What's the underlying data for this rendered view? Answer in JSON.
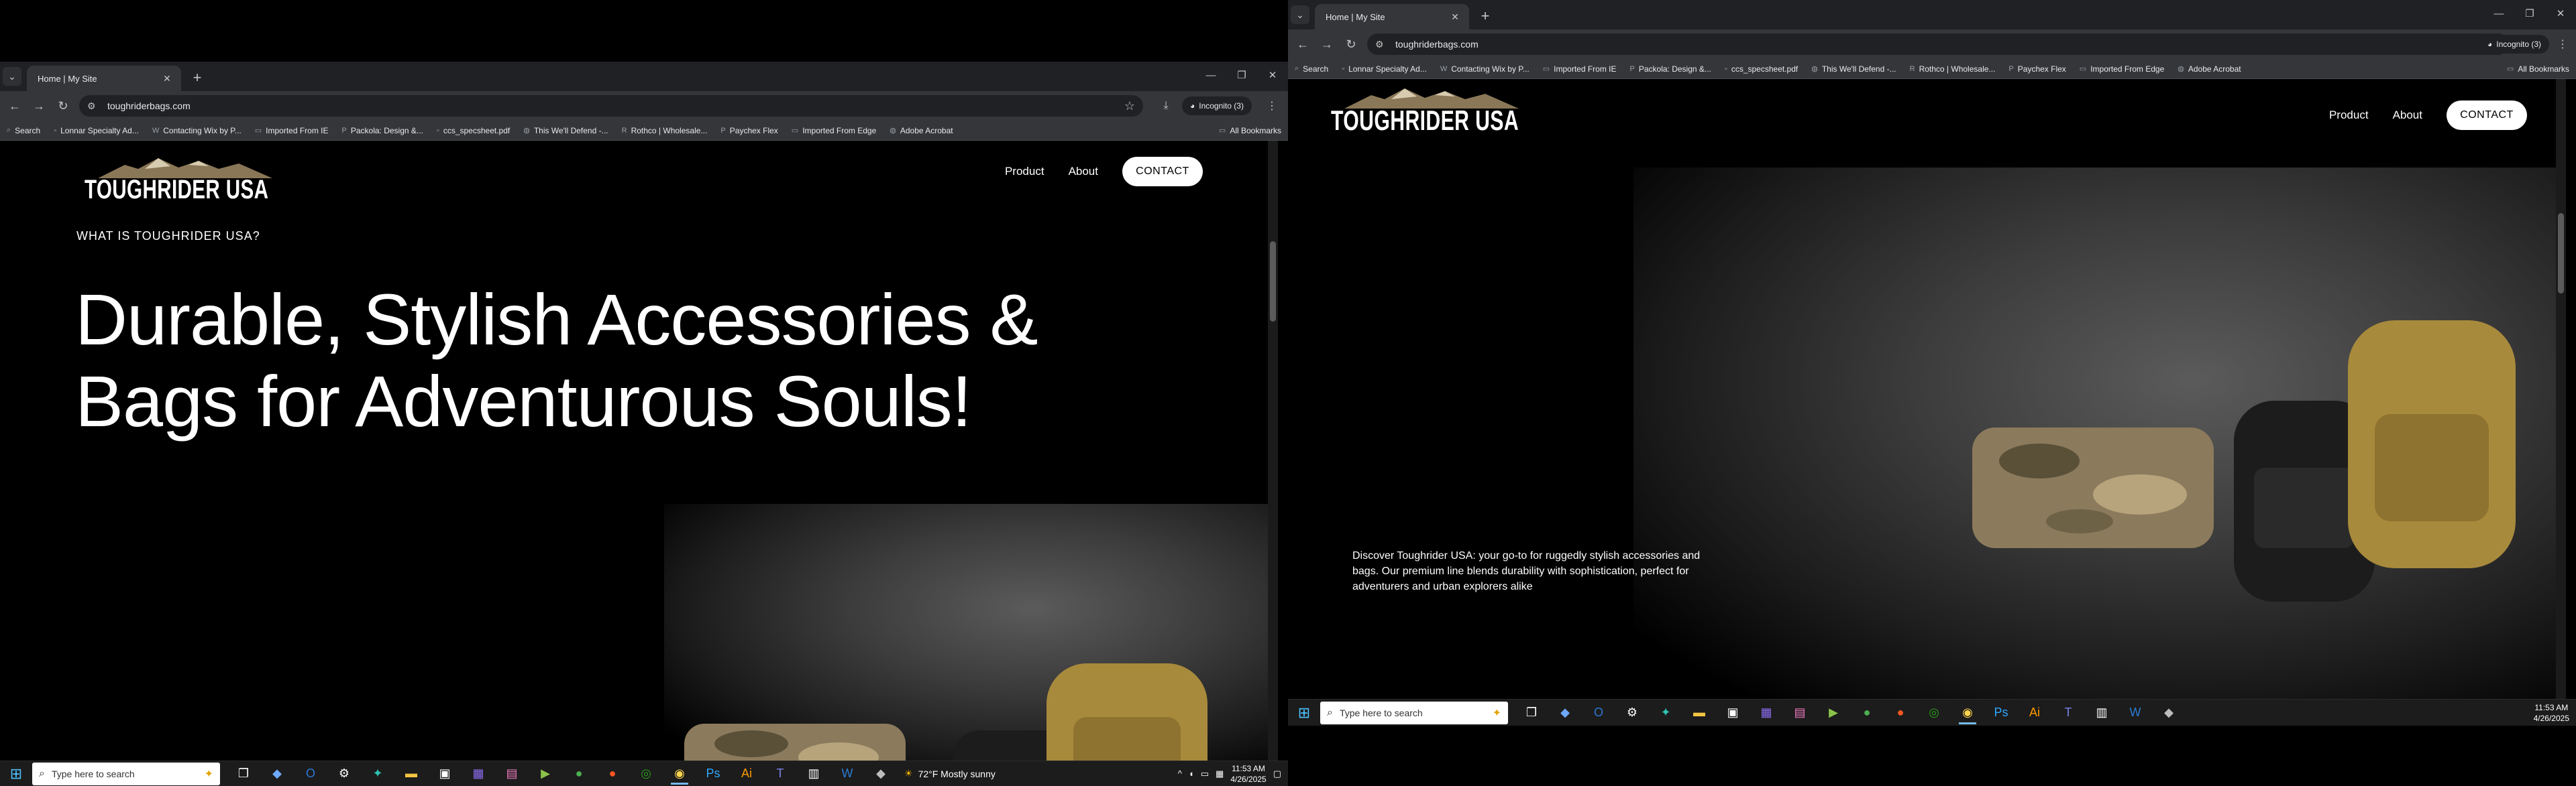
{
  "browser": {
    "tab_title": "Home | My Site",
    "url": "toughriderbags.com",
    "incognito_label": "Incognito (3)",
    "bookmarks": [
      {
        "icon": "search-icon",
        "label": "Search"
      },
      {
        "icon": "blank-icon",
        "label": "Lonnar Specialty Ad..."
      },
      {
        "icon": "wix-icon",
        "label": "Contacting Wix by P..."
      },
      {
        "icon": "folder-icon",
        "label": "Imported From IE"
      },
      {
        "icon": "pacsun-icon",
        "label": "Packola: Design &..."
      },
      {
        "icon": "blank-icon",
        "label": "ccs_specsheet.pdf"
      },
      {
        "icon": "globe-icon",
        "label": "This We'll Defend -..."
      },
      {
        "icon": "rothco-icon",
        "label": "Rothco | Wholesale..."
      },
      {
        "icon": "paychex-icon",
        "label": "Paychex Flex"
      },
      {
        "icon": "folder-icon",
        "label": "Imported From Edge"
      },
      {
        "icon": "globe-icon",
        "label": "Adobe Acrobat"
      }
    ],
    "all_bookmarks_label": "All Bookmarks"
  },
  "site": {
    "logo_text": "TOUGHRIDER USA",
    "nav": {
      "product": "Product",
      "about": "About",
      "contact": "CONTACT"
    },
    "eyebrow": "WHAT IS TOUGHRIDER USA?",
    "headline_line1": "Durable, Stylish Accessories &",
    "headline_line2": "Bags for Adventurous Souls!",
    "description": "Discover Toughrider USA: your go-to for ruggedly stylish accessories and bags. Our premium line blends durability with sophistication, perfect for adventurers and urban explorers alike"
  },
  "taskbar": {
    "search_placeholder": "Type here to search",
    "weather": "72°F  Mostly sunny",
    "time": "11:53 AM",
    "date": "4/26/2025",
    "apps": [
      {
        "name": "task-view-icon",
        "glyph": "❐",
        "color": "#ffffff"
      },
      {
        "name": "copilot-icon",
        "glyph": "◆",
        "color": "#6ea8ff"
      },
      {
        "name": "outlook-icon",
        "glyph": "O",
        "color": "#2b79d6"
      },
      {
        "name": "settings-icon",
        "glyph": "⚙",
        "color": "#ffffff"
      },
      {
        "name": "app-teal-icon",
        "glyph": "✦",
        "color": "#2ec4b6"
      },
      {
        "name": "file-explorer-icon",
        "glyph": "▬",
        "color": "#f4c542"
      },
      {
        "name": "capcut-icon",
        "glyph": "▣",
        "color": "#ffffff"
      },
      {
        "name": "media-icon",
        "glyph": "▦",
        "color": "#8c6cf0"
      },
      {
        "name": "photos-icon",
        "glyph": "▤",
        "color": "#f07ac0"
      },
      {
        "name": "app-green-icon",
        "glyph": "▶",
        "color": "#8bc34a"
      },
      {
        "name": "app-green2-icon",
        "glyph": "●",
        "color": "#4caf50"
      },
      {
        "name": "app-orange-icon",
        "glyph": "●",
        "color": "#ff5722"
      },
      {
        "name": "quickbooks-icon",
        "glyph": "◎",
        "color": "#2ca01c"
      },
      {
        "name": "chrome-icon",
        "glyph": "◉",
        "color": "#ffd54f"
      },
      {
        "name": "photoshop-icon",
        "glyph": "Ps",
        "color": "#31a8ff"
      },
      {
        "name": "illustrator-icon",
        "glyph": "Ai",
        "color": "#ff9a00"
      },
      {
        "name": "teams-icon",
        "glyph": "T",
        "color": "#7b83eb"
      },
      {
        "name": "notepad-icon",
        "glyph": "▥",
        "color": "#ffffff"
      },
      {
        "name": "word-icon",
        "glyph": "W",
        "color": "#2b7cd3"
      },
      {
        "name": "app-grey-icon",
        "glyph": "◆",
        "color": "#bdbdbd"
      }
    ]
  }
}
